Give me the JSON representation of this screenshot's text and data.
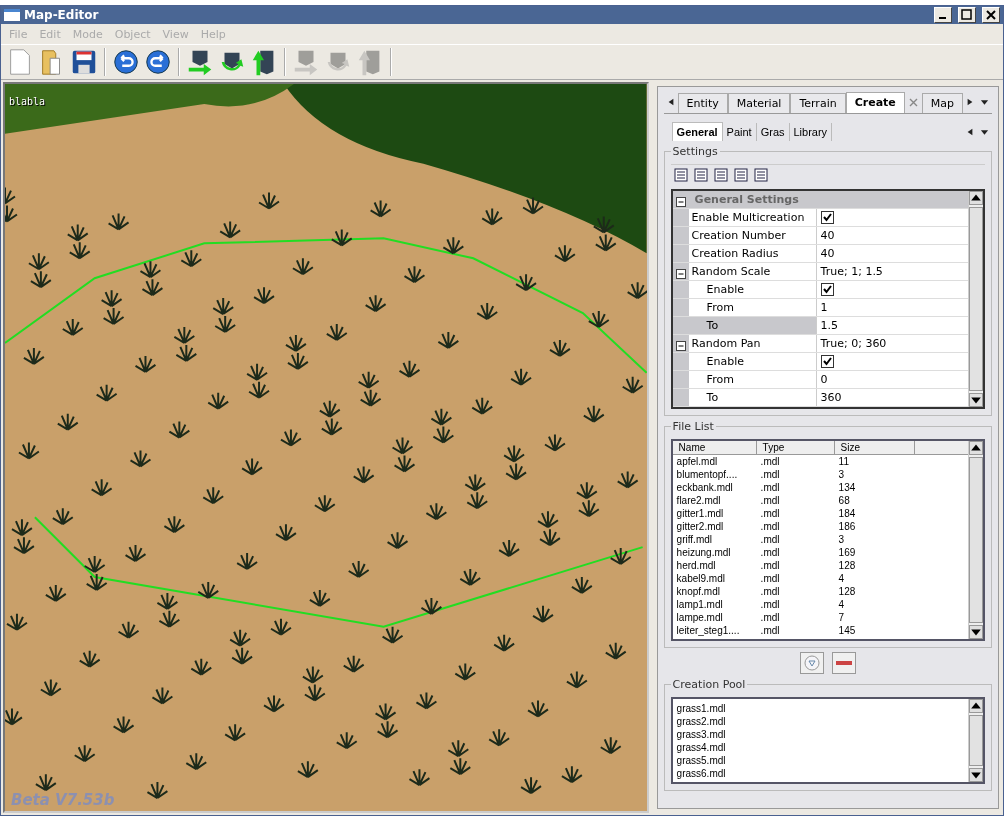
{
  "window": {
    "title": "Map-Editor"
  },
  "menu": [
    {
      "label": "File",
      "disabled": true
    },
    {
      "label": "Edit",
      "disabled": true
    },
    {
      "label": "Mode",
      "disabled": true
    },
    {
      "label": "Object",
      "disabled": true
    },
    {
      "label": "View",
      "disabled": true
    },
    {
      "label": "Help",
      "disabled": true
    }
  ],
  "toolbar": [
    {
      "kind": "new",
      "disabled": false
    },
    {
      "kind": "open",
      "disabled": false
    },
    {
      "kind": "save",
      "disabled": false
    },
    {
      "kind": "sep"
    },
    {
      "kind": "undo",
      "disabled": false
    },
    {
      "kind": "redo",
      "disabled": false
    },
    {
      "kind": "sep"
    },
    {
      "kind": "move",
      "disabled": false
    },
    {
      "kind": "rotate",
      "disabled": false
    },
    {
      "kind": "lift",
      "disabled": false
    },
    {
      "kind": "sep"
    },
    {
      "kind": "move",
      "disabled": true
    },
    {
      "kind": "rotate",
      "disabled": true
    },
    {
      "kind": "lift",
      "disabled": true
    },
    {
      "kind": "sep"
    }
  ],
  "viewport": {
    "label": "blabla",
    "version": "Beta V7.53b"
  },
  "tabs": [
    {
      "label": "Entity",
      "selected": false
    },
    {
      "label": "Material",
      "selected": false
    },
    {
      "label": "Terrain",
      "selected": false
    },
    {
      "label": "Create",
      "selected": true
    },
    {
      "label": "Map",
      "selected": false
    }
  ],
  "subtabs": [
    {
      "label": "General",
      "selected": true
    },
    {
      "label": "Paint",
      "selected": false
    },
    {
      "label": "Gras",
      "selected": false
    },
    {
      "label": "Library",
      "selected": false
    }
  ],
  "settings": {
    "title": "Settings",
    "rows": [
      {
        "kind": "category",
        "label": "General Settings",
        "expanded": true,
        "selected": false
      },
      {
        "kind": "property",
        "label": "Enable Multicreation",
        "checked": true,
        "selected": false
      },
      {
        "kind": "property",
        "label": "Creation Number",
        "value": "40",
        "selected": false
      },
      {
        "kind": "property",
        "label": "Creation Radius",
        "value": "40",
        "selected": false
      },
      {
        "kind": "group",
        "label": "Random Scale",
        "value": "True; 1; 1.5",
        "expanded": true,
        "selected": false
      },
      {
        "kind": "child",
        "label": "Enable",
        "checked": true,
        "selected": false
      },
      {
        "kind": "child",
        "label": "From",
        "value": "1",
        "selected": false
      },
      {
        "kind": "child",
        "label": "To",
        "value": "1.5",
        "selected": true
      },
      {
        "kind": "group",
        "label": "Random Pan",
        "value": "True; 0; 360",
        "expanded": true,
        "selected": false
      },
      {
        "kind": "child",
        "label": "Enable",
        "checked": true,
        "selected": false
      },
      {
        "kind": "child",
        "label": "From",
        "value": "0",
        "selected": false
      },
      {
        "kind": "child",
        "label": "To",
        "value": "360",
        "selected": false
      }
    ]
  },
  "file_list": {
    "title": "File List",
    "columns": [
      "Name",
      "Type",
      "Size"
    ],
    "rows": [
      [
        "apfel.mdl",
        ".mdl",
        "11"
      ],
      [
        "blumentopf....",
        ".mdl",
        "3"
      ],
      [
        "eckbank.mdl",
        ".mdl",
        "134"
      ],
      [
        "flare2.mdl",
        ".mdl",
        "68"
      ],
      [
        "gitter1.mdl",
        ".mdl",
        "184"
      ],
      [
        "gitter2.mdl",
        ".mdl",
        "186"
      ],
      [
        "griff.mdl",
        ".mdl",
        "3"
      ],
      [
        "heizung.mdl",
        ".mdl",
        "169"
      ],
      [
        "herd.mdl",
        ".mdl",
        "128"
      ],
      [
        "kabel9.mdl",
        ".mdl",
        "4"
      ],
      [
        "knopf.mdl",
        ".mdl",
        "128"
      ],
      [
        "lamp1.mdl",
        ".mdl",
        "4"
      ],
      [
        "lampe.mdl",
        ".mdl",
        "7"
      ],
      [
        "leiter_steg1....",
        ".mdl",
        "145"
      ]
    ]
  },
  "creation_pool": {
    "title": "Creation Pool",
    "items": [
      "grass1.mdl",
      "grass2.mdl",
      "grass3.mdl",
      "grass4.mdl",
      "grass5.mdl",
      "grass6.mdl"
    ]
  }
}
